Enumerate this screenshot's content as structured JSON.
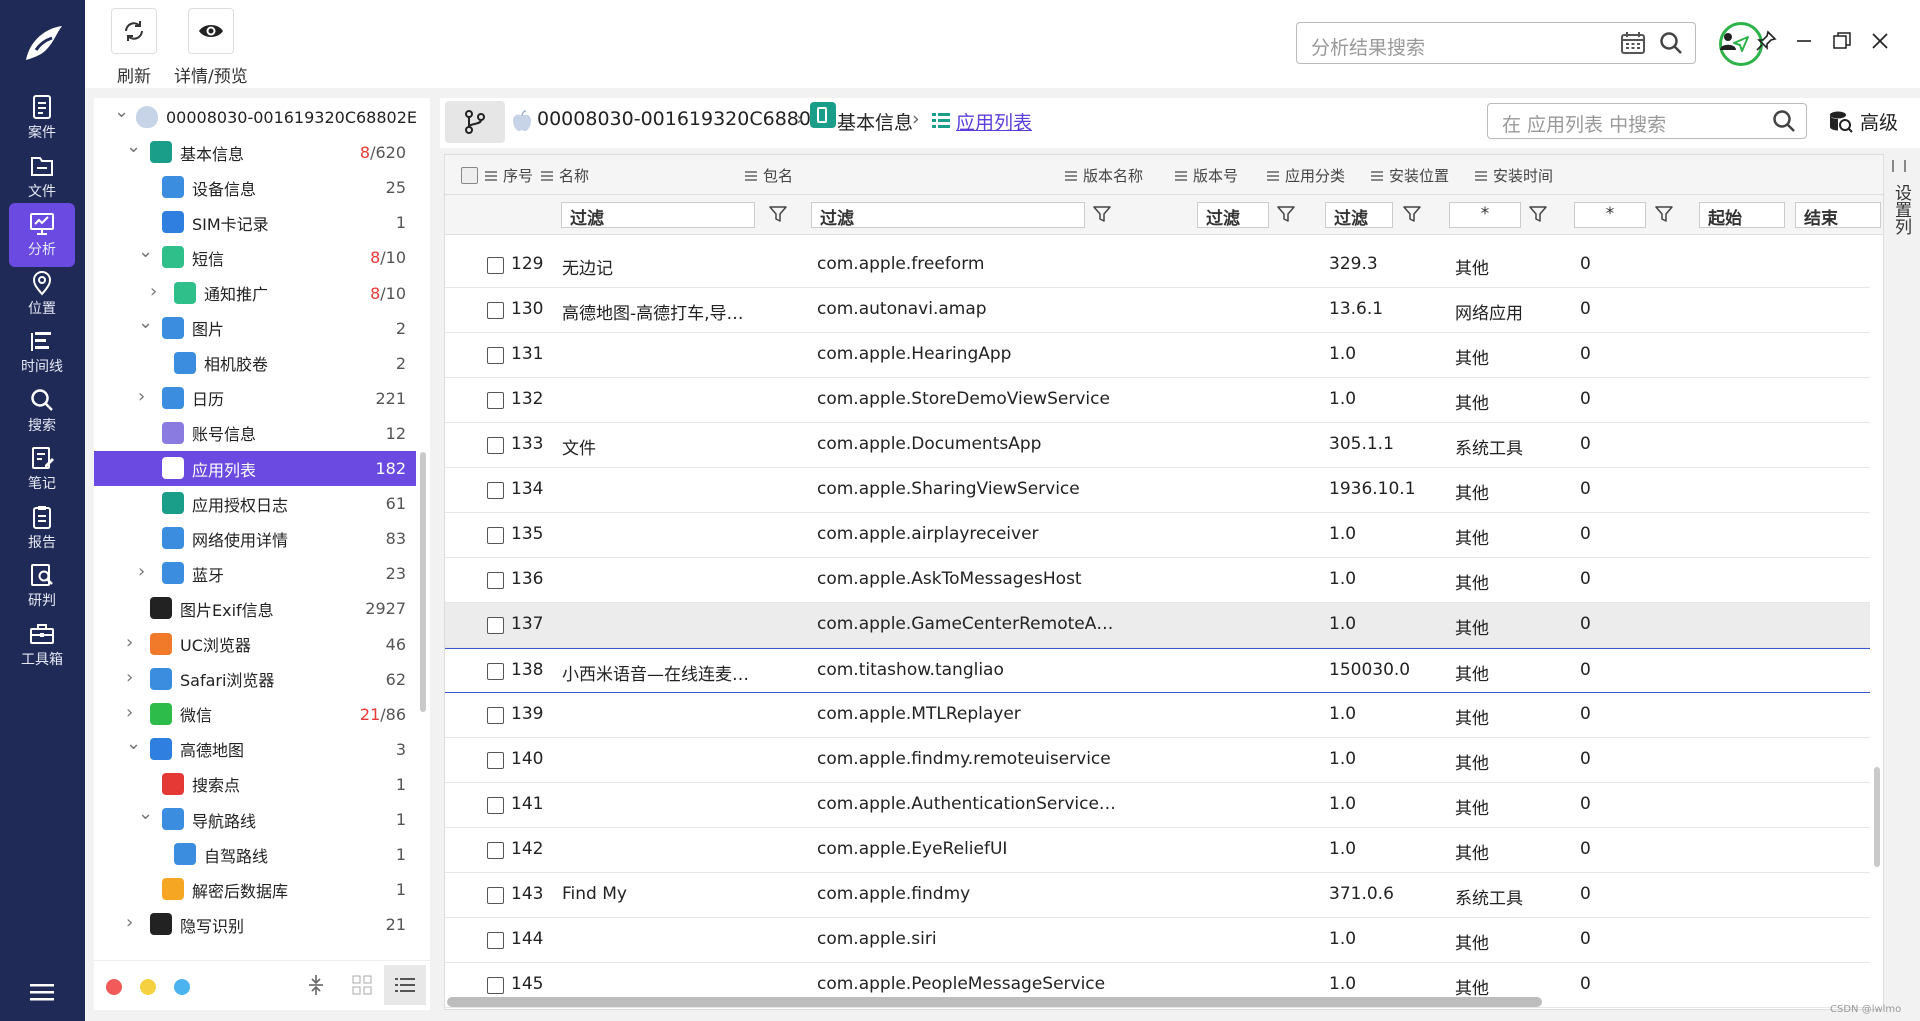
{
  "nav": {
    "items": [
      {
        "label": "案件",
        "icon": "case-icon"
      },
      {
        "label": "文件",
        "icon": "folder-icon"
      },
      {
        "label": "分析",
        "icon": "analysis-icon",
        "active": true
      },
      {
        "label": "位置",
        "icon": "location-icon"
      },
      {
        "label": "时间线",
        "icon": "timeline-icon"
      },
      {
        "label": "搜索",
        "icon": "search-icon"
      },
      {
        "label": "笔记",
        "icon": "note-icon"
      },
      {
        "label": "报告",
        "icon": "report-icon"
      },
      {
        "label": "研判",
        "icon": "judge-icon"
      },
      {
        "label": "工具箱",
        "icon": "toolbox-icon"
      }
    ],
    "accent": "#6a4ae0",
    "bg": "#1f2a57"
  },
  "toolbar": {
    "refresh_label": "刷新",
    "preview_label": "详情/预览",
    "search_placeholder": "分析结果搜索"
  },
  "tree": {
    "items": [
      {
        "label": "00008030-001619320C68802E",
        "count": "",
        "red": ""
      },
      {
        "label": "基本信息",
        "count": "/620",
        "red": "8"
      },
      {
        "label": "设备信息",
        "count": "25",
        "red": ""
      },
      {
        "label": "SIM卡记录",
        "count": "1",
        "red": ""
      },
      {
        "label": "短信",
        "count": "/10",
        "red": "8"
      },
      {
        "label": "通知推广",
        "count": "/10",
        "red": "8"
      },
      {
        "label": "图片",
        "count": "2",
        "red": ""
      },
      {
        "label": "相机胶卷",
        "count": "2",
        "red": ""
      },
      {
        "label": "日历",
        "count": "221",
        "red": ""
      },
      {
        "label": "账号信息",
        "count": "12",
        "red": ""
      },
      {
        "label": "应用列表",
        "count": "182",
        "red": ""
      },
      {
        "label": "应用授权日志",
        "count": "61",
        "red": ""
      },
      {
        "label": "网络使用详情",
        "count": "83",
        "red": ""
      },
      {
        "label": "蓝牙",
        "count": "23",
        "red": ""
      },
      {
        "label": "图片Exif信息",
        "count": "2927",
        "red": ""
      },
      {
        "label": "UC浏览器",
        "count": "46",
        "red": ""
      },
      {
        "label": "Safari浏览器",
        "count": "62",
        "red": ""
      },
      {
        "label": "微信",
        "count": "/86",
        "red": "21"
      },
      {
        "label": "高德地图",
        "count": "3",
        "red": ""
      },
      {
        "label": "搜索点",
        "count": "1",
        "red": ""
      },
      {
        "label": "导航路线",
        "count": "1",
        "red": ""
      },
      {
        "label": "自驾路线",
        "count": "1",
        "red": ""
      },
      {
        "label": "解密后数据库",
        "count": "1",
        "red": ""
      },
      {
        "label": "隐写识别",
        "count": "21",
        "red": ""
      }
    ]
  },
  "breadcrumb": {
    "device": "00008030-001619320C68802E",
    "section": "基本信息",
    "current": "应用列表",
    "search_placeholder": "在 应用列表 中搜索",
    "advanced_label": "高级"
  },
  "table": {
    "columns": [
      "序号",
      "名称",
      "包名",
      "版本名称",
      "版本号",
      "应用分类",
      "安装位置",
      "安装时间"
    ],
    "filter_placeholder": "过滤",
    "filter_star": "*",
    "time_start": "起始",
    "time_end": "结束",
    "rows": [
      {
        "no": "129",
        "name": "无边记",
        "pkg": "com.apple.freeform",
        "ver": "329.3",
        "cat": "其他",
        "loc": "0"
      },
      {
        "no": "130",
        "name": "高德地图-高德打车,导航公...",
        "pkg": "com.autonavi.amap",
        "ver": "13.6.1",
        "cat": "网络应用",
        "loc": "0"
      },
      {
        "no": "131",
        "name": "",
        "pkg": "com.apple.HearingApp",
        "ver": "1.0",
        "cat": "其他",
        "loc": "0"
      },
      {
        "no": "132",
        "name": "",
        "pkg": "com.apple.StoreDemoViewService",
        "ver": "1.0",
        "cat": "其他",
        "loc": "0"
      },
      {
        "no": "133",
        "name": "文件",
        "pkg": "com.apple.DocumentsApp",
        "ver": "305.1.1",
        "cat": "系统工具",
        "loc": "0"
      },
      {
        "no": "134",
        "name": "",
        "pkg": "com.apple.SharingViewService",
        "ver": "1936.10.1",
        "cat": "其他",
        "loc": "0"
      },
      {
        "no": "135",
        "name": "",
        "pkg": "com.apple.airplayreceiver",
        "ver": "1.0",
        "cat": "其他",
        "loc": "0"
      },
      {
        "no": "136",
        "name": "",
        "pkg": "com.apple.AskToMessagesHost",
        "ver": "1.0",
        "cat": "其他",
        "loc": "0"
      },
      {
        "no": "137",
        "name": "",
        "pkg": "com.apple.GameCenterRemoteAlert",
        "ver": "1.0",
        "cat": "其他",
        "loc": "0"
      },
      {
        "no": "138",
        "name": "小西米语音—在线连麦社...",
        "pkg": "com.titashow.tangliao",
        "ver": "150030.0",
        "cat": "其他",
        "loc": "0"
      },
      {
        "no": "139",
        "name": "",
        "pkg": "com.apple.MTLReplayer",
        "ver": "1.0",
        "cat": "其他",
        "loc": "0"
      },
      {
        "no": "140",
        "name": "",
        "pkg": "com.apple.findmy.remoteuiservice",
        "ver": "1.0",
        "cat": "其他",
        "loc": "0"
      },
      {
        "no": "141",
        "name": "",
        "pkg": "com.apple.AuthenticationServicesUI",
        "ver": "1.0",
        "cat": "其他",
        "loc": "0"
      },
      {
        "no": "142",
        "name": "",
        "pkg": "com.apple.EyeReliefUI",
        "ver": "1.0",
        "cat": "其他",
        "loc": "0"
      },
      {
        "no": "143",
        "name": "Find My",
        "pkg": "com.apple.findmy",
        "ver": "371.0.6",
        "cat": "系统工具",
        "loc": "0"
      },
      {
        "no": "144",
        "name": "",
        "pkg": "com.apple.siri",
        "ver": "1.0",
        "cat": "其他",
        "loc": "0"
      },
      {
        "no": "145",
        "name": "",
        "pkg": "com.apple.PeopleMessageService",
        "ver": "1.0",
        "cat": "其他",
        "loc": "0"
      }
    ]
  },
  "settings_column_label": "设置列",
  "watermark": "CSDN @lwlmo"
}
